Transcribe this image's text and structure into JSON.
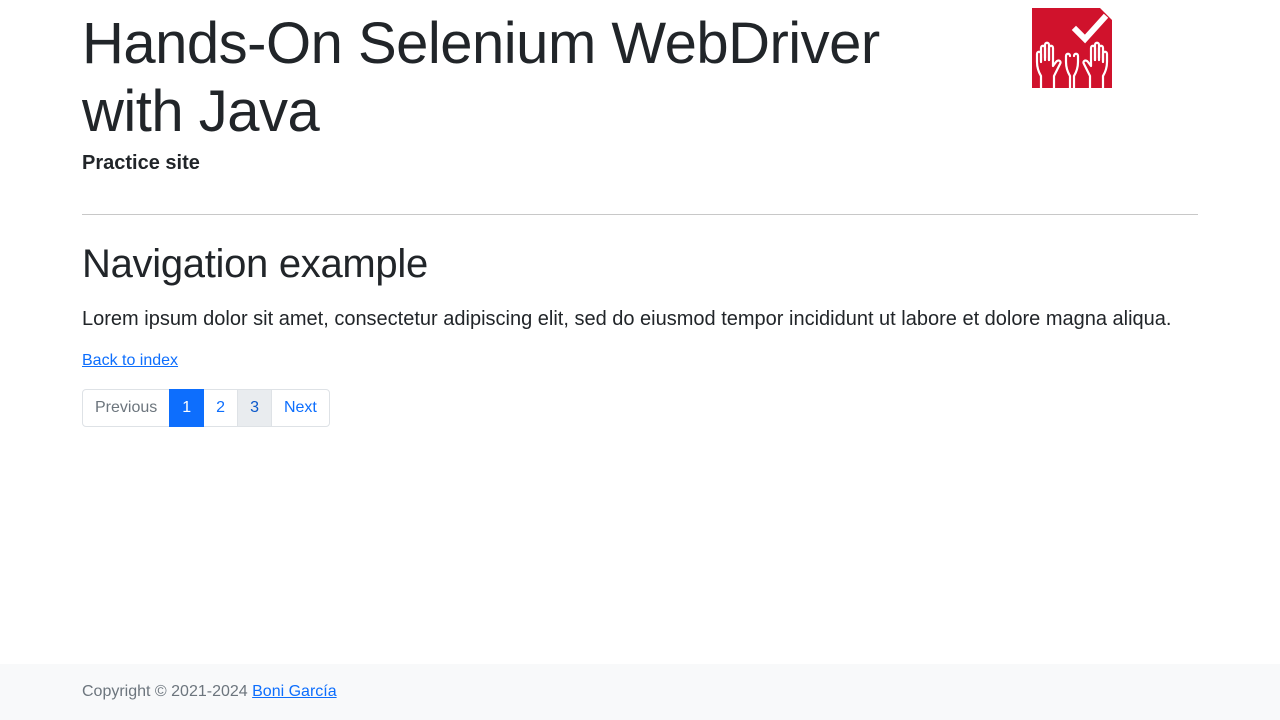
{
  "header": {
    "title": "Hands-On Selenium WebDriver with Java",
    "subtitle": "Practice site",
    "logo_icon": "hands-checkmark-logo-icon",
    "logo_color": "#d0122c"
  },
  "main": {
    "heading": "Navigation example",
    "paragraph": "Lorem ipsum dolor sit amet, consectetur adipiscing elit, sed do eiusmod tempor incididunt ut labore et dolore magna aliqua.",
    "back_link": "Back to index",
    "pagination": {
      "previous": "Previous",
      "pages": [
        "1",
        "2",
        "3"
      ],
      "next": "Next",
      "active_page": "1",
      "active_color": "#0d6efd"
    }
  },
  "footer": {
    "copyright": "Copyright © 2021-2024",
    "author_link": "Boni García"
  }
}
